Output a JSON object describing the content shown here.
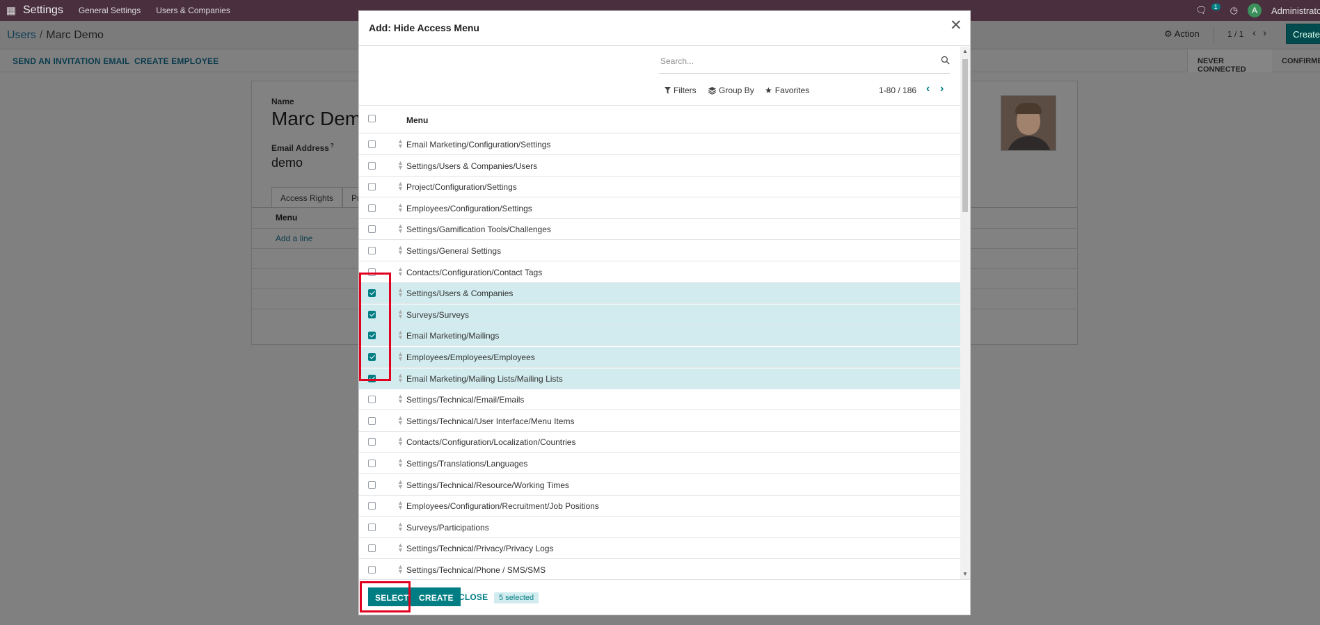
{
  "topbar": {
    "app_name": "Settings",
    "menus": [
      "General Settings",
      "Users & Companies"
    ],
    "chat_count": "1",
    "avatar_letter": "A",
    "user_name": "Administrator"
  },
  "breadcrumb": {
    "parent": "Users",
    "current": "Marc Demo"
  },
  "control_panel": {
    "action_label": "Action",
    "pager": "1 / 1",
    "create_label": "Create"
  },
  "status_bar": {
    "buttons": [
      "SEND AN INVITATION EMAIL",
      "CREATE EMPLOYEE"
    ],
    "states": [
      "NEVER CONNECTED",
      "CONFIRMED"
    ]
  },
  "form": {
    "name_label": "Name",
    "name_value": "Marc Demo",
    "email_label": "Email Address",
    "email_help": "?",
    "email_value": "demo",
    "tabs": [
      "Access Rights",
      "Preferences"
    ],
    "menu_column": "Menu",
    "add_line": "Add a line"
  },
  "modal": {
    "title": "Add: Hide Access Menu",
    "search": {
      "placeholder": "Search..."
    },
    "filters_label": "Filters",
    "group_by_label": "Group By",
    "favorites_label": "Favorites",
    "pager": "1-80 / 186",
    "column_header": "Menu",
    "rows": [
      {
        "label": "Email Marketing/Configuration/Settings",
        "checked": false
      },
      {
        "label": "Settings/Users & Companies/Users",
        "checked": false
      },
      {
        "label": "Project/Configuration/Settings",
        "checked": false
      },
      {
        "label": "Employees/Configuration/Settings",
        "checked": false
      },
      {
        "label": "Settings/Gamification Tools/Challenges",
        "checked": false
      },
      {
        "label": "Settings/General Settings",
        "checked": false
      },
      {
        "label": "Contacts/Configuration/Contact Tags",
        "checked": false
      },
      {
        "label": "Settings/Users & Companies",
        "checked": true
      },
      {
        "label": "Surveys/Surveys",
        "checked": true
      },
      {
        "label": "Email Marketing/Mailings",
        "checked": true
      },
      {
        "label": "Employees/Employees/Employees",
        "checked": true
      },
      {
        "label": "Email Marketing/Mailing Lists/Mailing Lists",
        "checked": true
      },
      {
        "label": "Settings/Technical/Email/Emails",
        "checked": false
      },
      {
        "label": "Settings/Technical/User Interface/Menu Items",
        "checked": false
      },
      {
        "label": "Contacts/Configuration/Localization/Countries",
        "checked": false
      },
      {
        "label": "Settings/Translations/Languages",
        "checked": false
      },
      {
        "label": "Settings/Technical/Resource/Working Times",
        "checked": false
      },
      {
        "label": "Employees/Configuration/Recruitment/Job Positions",
        "checked": false
      },
      {
        "label": "Surveys/Participations",
        "checked": false
      },
      {
        "label": "Settings/Technical/Privacy/Privacy Logs",
        "checked": false
      },
      {
        "label": "Settings/Technical/Phone / SMS/SMS",
        "checked": false
      }
    ],
    "footer": {
      "select_label": "SELECT",
      "create_label": "CREATE",
      "close_label": "CLOSE",
      "selected_text": "5 selected"
    }
  },
  "colors": {
    "accent": "#017e84",
    "selected_row": "#d2ebee",
    "highlight": "#e00020",
    "navbar": "#4a2f3e"
  }
}
